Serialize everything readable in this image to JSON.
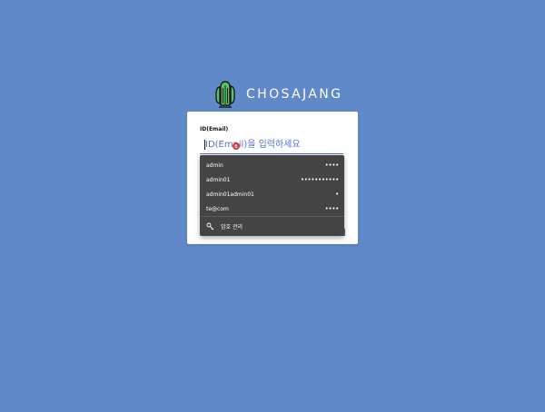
{
  "brand": {
    "name": "CHOSAJANG",
    "logo_icon": "cactus-icon",
    "logo_colors": {
      "fill": "#5bc26a",
      "stroke": "#1b1b1b"
    }
  },
  "login_form": {
    "id_label": "ID(Email)",
    "id_placeholder": "ID(Email)을 입력하세요"
  },
  "autofill": {
    "suggestions": [
      {
        "username": "admin",
        "password_mask": "••••"
      },
      {
        "username": "admin01",
        "password_mask": "•••••••••••"
      },
      {
        "username": "admin01admin01",
        "password_mask": "•"
      },
      {
        "username": "te@com",
        "password_mask": "••••"
      }
    ],
    "manage_label": "암호 관리",
    "manage_icon": "key-icon"
  },
  "colors": {
    "background": "#5f89c9",
    "accent": "#4a69c9",
    "dropdown_bg": "#444445",
    "cursor_highlight": "#e3342f"
  }
}
